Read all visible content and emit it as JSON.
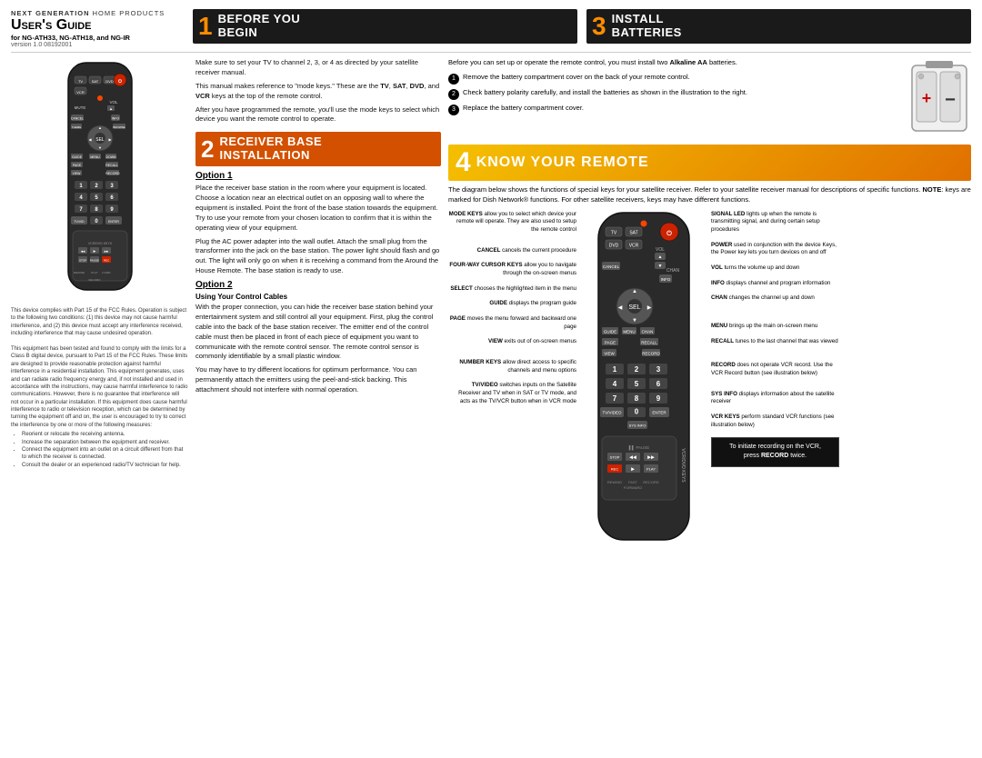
{
  "brand": {
    "company": "NEXT GENERATION HOME PRODUCTS",
    "guide_title": "User's Guide",
    "for_models": "for NG-ATH33, NG-ATH18, and NG-IR",
    "version": "version 1.0   08192001"
  },
  "section1": {
    "number": "1",
    "title": "BEFORE YOU\nBEGIN",
    "body1": "Make sure to set your TV to channel 2, 3, or 4 as directed by your satellite receiver manual.",
    "body2": "This manual makes reference to \"mode keys.\" These are the TV, SAT, DVD, and VCR keys at the top of the remote control.",
    "body3": "After you have programmed the remote, you'll use the mode keys to select which device you want the remote control to operate."
  },
  "section2": {
    "number": "2",
    "title": "RECEIVER BASE\nINSTALLATION",
    "option1_heading": "Option 1",
    "option1_body1": "Place the receiver base station in the room where your equipment is located. Choose a location near an electrical outlet on an opposing wall to where the equipment is installed. Point the front of the base station towards the equipment. Try to use your remote from your chosen location to confirm that it is within the operating view of your equipment.",
    "option1_body2": "Plug the AC power adapter into the wall outlet. Attach the small plug from the transformer into the jack on the base station. The power light should flash and go out. The light will only go on when it is receiving a command from the Around the House Remote. The base station is ready to use.",
    "option2_heading": "Option 2",
    "option2_sub": "Using Your Control Cables",
    "option2_body1": "With the proper connection, you can hide the receiver base station behind your entertainment system and still control all your equipment. First, plug the control cable into the back of the base station receiver. The emitter end of the control cable must then be placed in front of each piece of equipment you want to communicate with the remote control sensor. The remote control sensor is commonly identifiable by a small plastic window.",
    "option2_body2": "You may have to try different locations for optimum performance. You can permanently attach the emitters using the peel-and-stick backing. This attachment should not interfere with normal operation."
  },
  "section3": {
    "number": "3",
    "title": "INSTALL\nBATTERIES",
    "intro": "Before you can set up or operate the remote control, you must install two Alkaline AA batteries.",
    "step1": "Remove the battery compartment cover on the back of your remote control.",
    "step2": "Check battery polarity carefully, and install the batteries as shown in the illustration to the right.",
    "step3": "Replace the battery compartment cover."
  },
  "section4": {
    "number": "4",
    "title": "KNOW YOUR REMOTE",
    "intro": "The diagram below shows the functions of special keys for your satellite receiver. Refer to your satellite receiver manual for descriptions of specific functions. NOTE: keys are marked for Dish Network® functions. For other satellite receivers, keys may have different functions.",
    "labels_left": [
      {
        "bold": "MODE KEYS",
        "text": " allow you to select which device your remote will operate. They are also used to setup the remote control"
      },
      {
        "bold": "CANCEL",
        "text": " cancels the current procedure"
      },
      {
        "bold": "FOUR-WAY CURSOR KEYS",
        "text": " allow you to navigate through the on-screen menus"
      },
      {
        "bold": "SELECT",
        "text": " chooses the highlighted item in the menu"
      },
      {
        "bold": "GUIDE",
        "text": " displays the program guide"
      },
      {
        "bold": "PAGE",
        "text": " moves the menu forward and backward one page"
      },
      {
        "bold": "VIEW",
        "text": " exits out of on-screen menus"
      },
      {
        "bold": "NUMBER KEYS",
        "text": " allow direct access to specific channels and menu options"
      },
      {
        "bold": "TV/VIDEO",
        "text": " switches inputs on the Satellite Receiver and TV when in SAT or TV mode, and acts as the TV/VCR button when in VCR mode"
      }
    ],
    "labels_right": [
      {
        "bold": "SIGNAL LED",
        "text": " lights up when the remote is transmitting signal, and during certain setup procedures"
      },
      {
        "bold": "POWER",
        "text": " used in conjunction with the device Keys, the Power key lets you turn devices on and off"
      },
      {
        "bold": "VOL",
        "text": " turns the volume up and down"
      },
      {
        "bold": "INFO",
        "text": " displays channel and program information"
      },
      {
        "bold": "CHAN",
        "text": " changes the channel up and down"
      },
      {
        "bold": "MENU",
        "text": " brings up the main on-screen menu"
      },
      {
        "bold": "RECALL",
        "text": " tunes to the last channel that was viewed"
      },
      {
        "bold": "RECORD",
        "text": " does not operate VCR record. Use the VCR Record button (see illustration below)"
      },
      {
        "bold": "SYS INFO",
        "text": " displays information about the satellite receiver"
      },
      {
        "bold": "VCR KEYS",
        "text": " perform standard VCR functions (see illustration below)"
      }
    ],
    "vcr_tip": "To initiate recording on the VCR, press RECORD twice."
  },
  "fcc": {
    "body": "This device complies with Part 15 of the FCC Rules. Operation is subject to the following two conditions: (1) this device may not cause harmful interference, and (2) this device must accept any interference received, including interference that may cause undesired operation.",
    "body2": "This equipment has been tested and found to comply with the limits for a Class B digital device, pursuant to Part 15 of the FCC Rules. These limits are designed to provide reasonable protection against harmful interference in a residential installation. This equipment generates, uses and can radiate radio frequency energy and, if not installed and used in accordance with the instructions, may cause harmful interference to radio communications. However, there is no guarantee that interference will not occur in a particular installation. If this equipment does cause harmful interference to radio or television reception, which can be determined by turning the equipment off and on, the user is encouraged to try to correct the interference by one or more of the following measures:",
    "bullets": [
      "Reorient or relocate the receiving antenna.",
      "Increase the separation between the equipment and receiver.",
      "Connect the equipment into an outlet on a circuit different from that to which the receiver is connected.",
      "Consult the dealer or an experienced radio/TV technician for help."
    ]
  }
}
